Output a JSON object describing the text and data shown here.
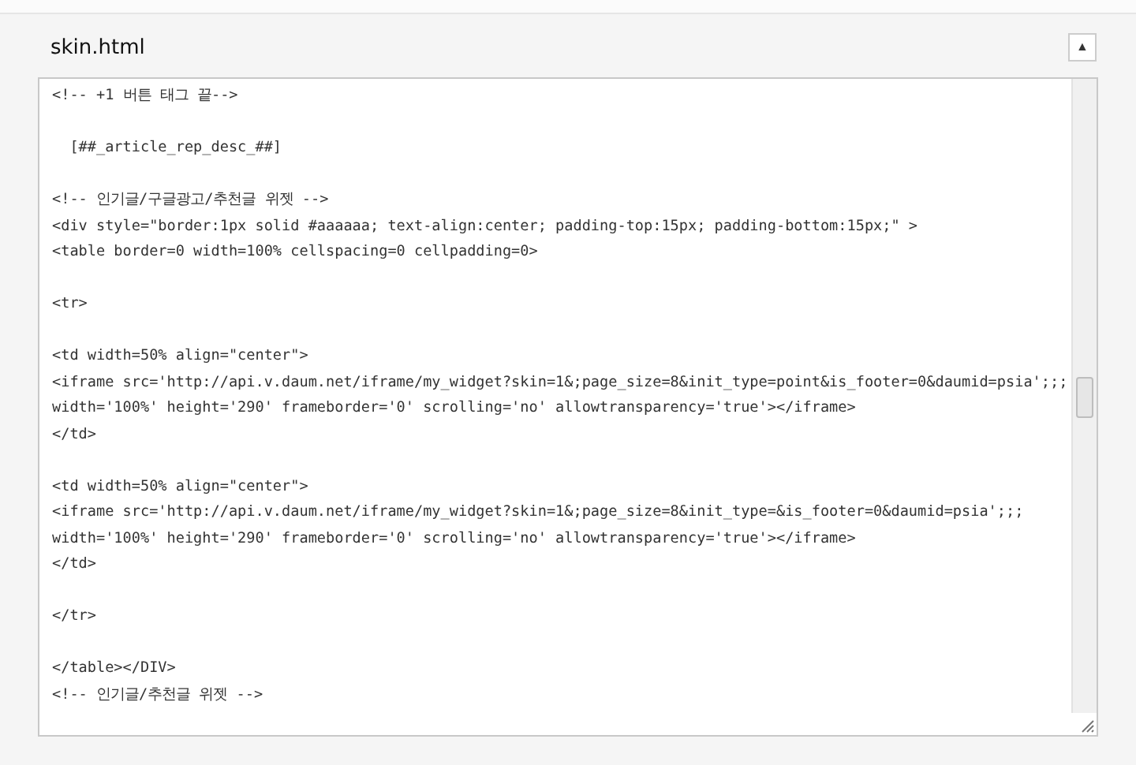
{
  "panel": {
    "title": "skin.html",
    "collapse_button": "▲"
  },
  "editor": {
    "blocks": [
      [
        "<!-- +1 버튼 태그 끝-->"
      ],
      [
        "  [##_article_rep_desc_##]"
      ],
      [
        "<!-- 인기글/구글광고/추천글 위젯 -->",
        "<div style=\"border:1px solid #aaaaaa; text-align:center; padding-top:15px; padding-bottom:15px;\" >",
        "<table border=0 width=100% cellspacing=0 cellpadding=0>"
      ],
      [
        "<tr>"
      ],
      [
        "<td width=50% align=\"center\">",
        "<iframe src='http://api.v.daum.net/iframe/my_widget?skin=1&;page_size=8&init_type=point&is_footer=0&daumid=psia';;;",
        "width='100%' height='290' frameborder='0' scrolling='no' allowtransparency='true'></iframe>",
        "</td>"
      ],
      [
        "<td width=50% align=\"center\">",
        "<iframe src='http://api.v.daum.net/iframe/my_widget?skin=1&;page_size=8&init_type=&is_footer=0&daumid=psia';;;",
        "width='100%' height='290' frameborder='0' scrolling='no' allowtransparency='true'></iframe>",
        "</td>"
      ],
      [
        "</tr>"
      ],
      [
        "</table></DIV>",
        "<!-- 인기글/추천글 위젯 -->"
      ]
    ]
  }
}
